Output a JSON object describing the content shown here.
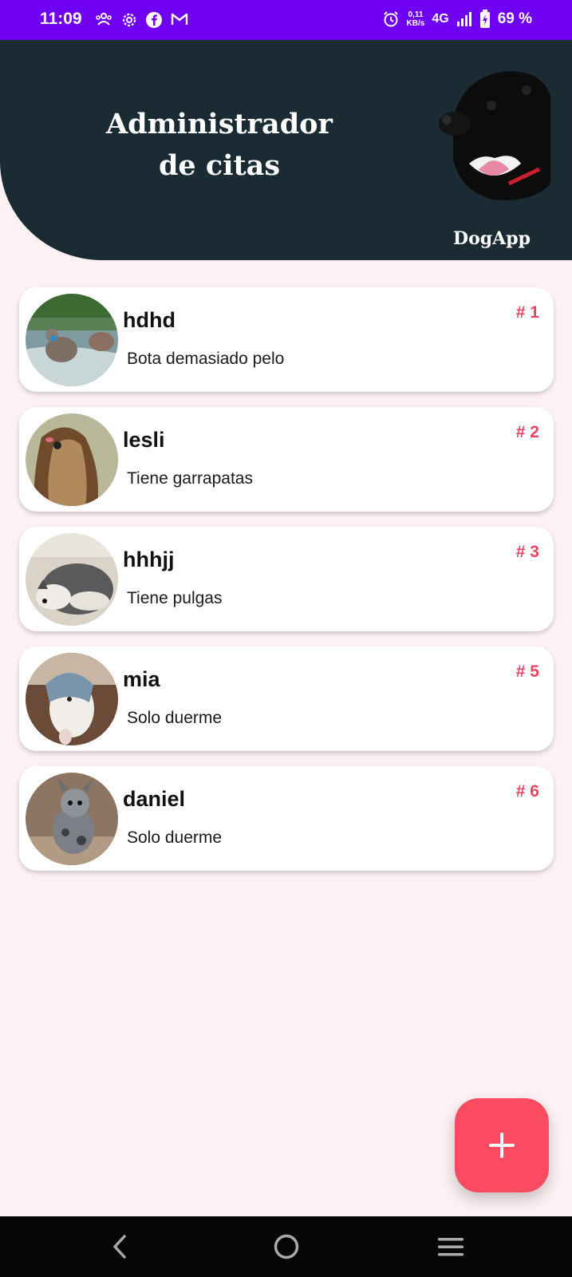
{
  "status_bar": {
    "time": "11:09",
    "speed_top": "0,11",
    "speed_bottom": "KB/s",
    "network": "4G",
    "battery": "69 %"
  },
  "header": {
    "title_line1": "Administrador",
    "title_line2": "de citas",
    "brand": "DogApp"
  },
  "appointments": [
    {
      "name": "hdhd",
      "description": "Bota demasiado pelo",
      "number": "# 1"
    },
    {
      "name": "lesli",
      "description": "Tiene garrapatas",
      "number": "# 2"
    },
    {
      "name": "hhhjj",
      "description": "Tiene pulgas",
      "number": "# 3"
    },
    {
      "name": "mia",
      "description": "Solo duerme",
      "number": "# 5"
    },
    {
      "name": "daniel",
      "description": "Solo duerme",
      "number": "# 6"
    }
  ],
  "fab": {
    "icon": "plus-icon"
  },
  "nav": {
    "icons": [
      "back-icon",
      "home-icon",
      "recents-icon"
    ]
  },
  "colors": {
    "status_bar": "#6f00f3",
    "header": "#1b2b34",
    "background": "#fdf1f4",
    "accent": "#fb4b61",
    "number": "#e64563"
  }
}
